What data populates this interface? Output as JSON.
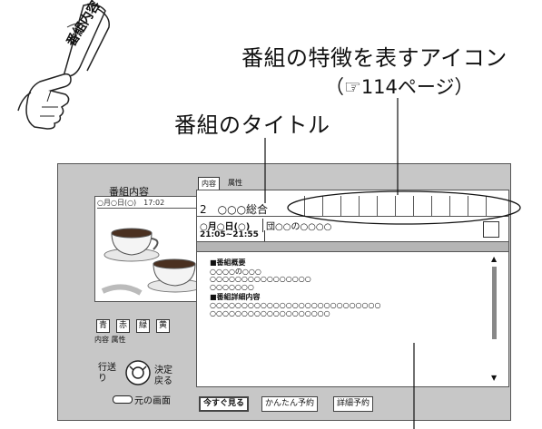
{
  "badge": {
    "label": "番組内容"
  },
  "captions": {
    "icon_caption": "番組の特徴を表すアイコン",
    "page_ref": "（☞114ページ）",
    "title_caption": "番組のタイトル"
  },
  "left_panel": {
    "heading": "番組内容",
    "date_time": "○月○日(○)　17:02",
    "color_buttons": [
      {
        "label": "青",
        "color": "#3050c0"
      },
      {
        "label": "赤",
        "color": "#c03030"
      },
      {
        "label": "緑",
        "color": "#30a040"
      },
      {
        "label": "黄",
        "color": "#c0a020"
      }
    ],
    "color_button_captions": "内容 属性",
    "nav_left": "行送り",
    "nav_enter": "決定",
    "nav_back": "戻る",
    "return_label": "元の画面"
  },
  "tabs": [
    {
      "label": "内容"
    },
    {
      "label": "属性"
    }
  ],
  "program": {
    "channel": "2　○○○総合",
    "date": "○月○日(○)",
    "genre_box": "団○○の○○○○",
    "time": "21:05~21:55"
  },
  "description": {
    "summary_heading": "■番組概要",
    "summary_lines": [
      "○○○○の○○○",
      "○○○○○○○○○○○○○○○○",
      "○○○○○○○"
    ],
    "detail_heading": "■番組詳細内容",
    "detail_lines": [
      "○○○○○○○○○○○○○○○○○○○○○○○○○○○",
      "○○○○○○○○○○○○○○○○○○○"
    ]
  },
  "actions": {
    "watch_now": "今すぐ見る",
    "easy_reserve": "かんたん予約",
    "detail_reserve": "詳細予約"
  },
  "colors": {
    "screen_bg": "#c7c7c7",
    "panel_bg": "#ffffff",
    "scrollbar": "#888888"
  }
}
